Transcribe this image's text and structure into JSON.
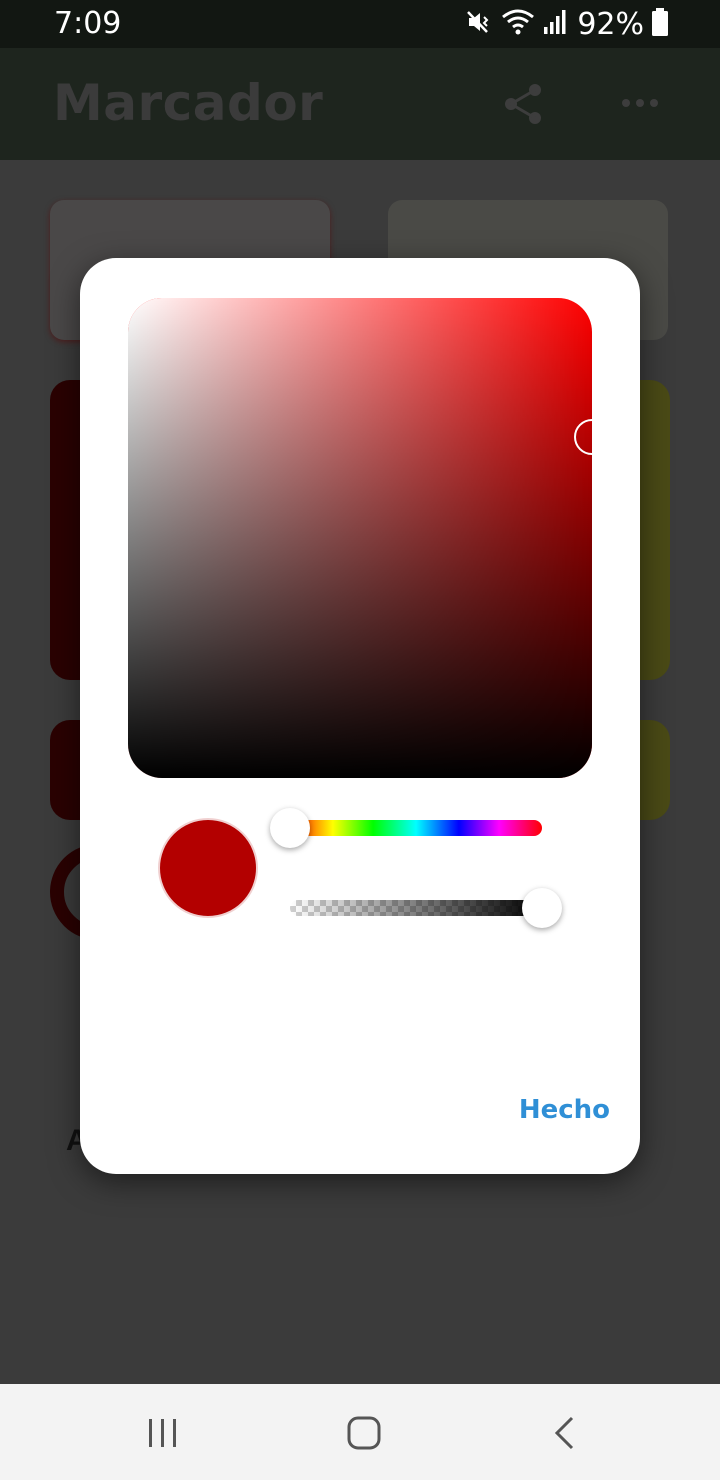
{
  "status_bar": {
    "time": "7:09",
    "battery_percent": "92%",
    "icons": [
      "mute-vibrate-icon",
      "wifi-icon",
      "signal-icon",
      "battery-icon"
    ]
  },
  "app_bar": {
    "title": "Marcador",
    "actions": [
      "share-icon",
      "more-icon"
    ]
  },
  "color_picker": {
    "hue_degrees": 0,
    "saturation": 1.0,
    "value": 0.71,
    "hue_fraction": 0.0,
    "alpha_fraction": 1.0,
    "selected_color": "#b30000",
    "pure_hue_color": "#ff0000",
    "done_label": "Hecho"
  },
  "background": {
    "partial_letter": "A"
  },
  "colors": {
    "accent_blue": "#2f8fd6",
    "overlay_dim": "#3b3b3b"
  },
  "nav_bar": {
    "buttons": [
      "recent-apps-icon",
      "home-icon",
      "back-icon"
    ]
  }
}
